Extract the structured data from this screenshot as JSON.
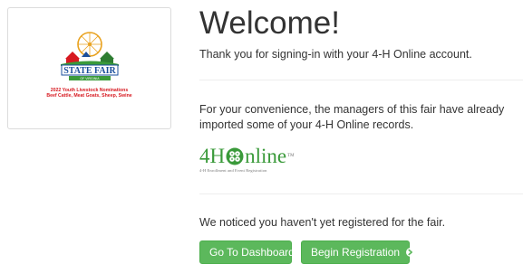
{
  "logo": {
    "brand_line1": "STATE FAIR",
    "brand_line2": "OF VIRGINIA",
    "caption_line1": "2022 Youth Livestock Nominations",
    "caption_line2": "Beef Cattle, Meat Goats, Sheep, Swine"
  },
  "main": {
    "title": "Welcome!",
    "thanks_text": "Thank you for signing-in with your 4-H Online account.",
    "convenience_text": "For your convenience, the managers of this fair have already imported some of your 4-H Online records.",
    "fourh_logo": {
      "word_prefix": "4H",
      "word_suffix": "nline",
      "trademark": "TM",
      "subtitle": "4-H Enrollment and Event Registration"
    },
    "notice_text": "We noticed you haven't yet registered for the fair.",
    "buttons": {
      "dashboard_label": "Go To Dashboard",
      "register_label": "Begin Registration"
    }
  },
  "colors": {
    "button_green": "#5cb85c",
    "fourh_green": "#3a9a3a",
    "fair_red": "#d71920"
  },
  "icons": [
    "state-fair-logo-icon",
    "four-h-clover-icon",
    "arrow-circle-right-icon"
  ]
}
